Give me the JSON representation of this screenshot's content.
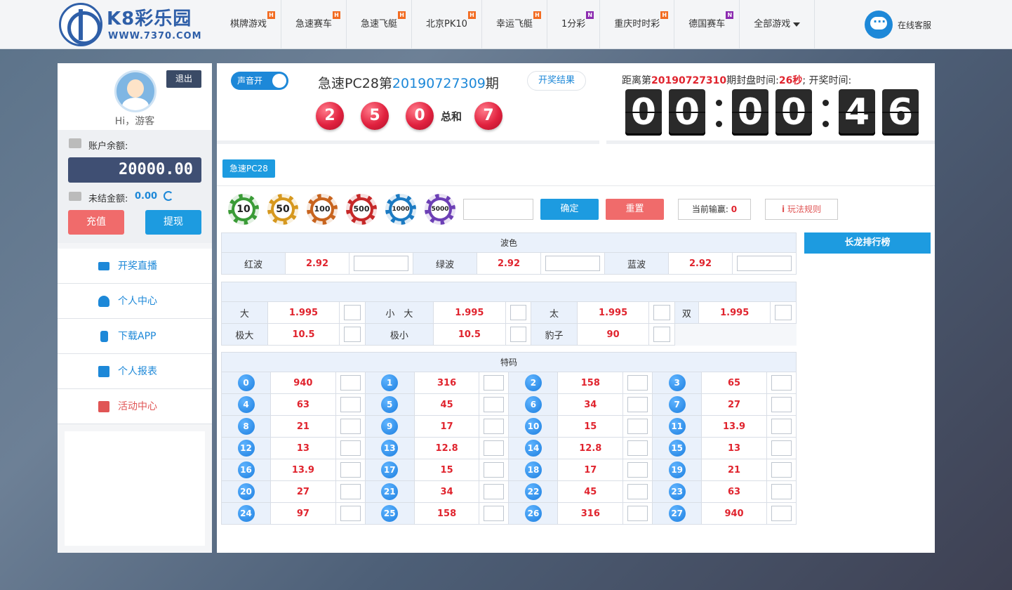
{
  "brand": {
    "title": "K8彩乐园",
    "url": "WWW.7370.COM"
  },
  "nav": [
    {
      "label": "棋牌游戏",
      "badge": "H"
    },
    {
      "label": "急速赛车",
      "badge": "H"
    },
    {
      "label": "急速飞艇",
      "badge": "H"
    },
    {
      "label": "北京PK10",
      "badge": "H"
    },
    {
      "label": "幸运飞艇",
      "badge": "H"
    },
    {
      "label": "1分彩",
      "badge": "N"
    },
    {
      "label": "重庆时时彩",
      "badge": "H"
    },
    {
      "label": "德国赛车",
      "badge": "N"
    },
    {
      "label": "全部游戏",
      "badge": ""
    }
  ],
  "service_label": "在线客服",
  "user": {
    "logout": "退出",
    "greeting": "Hi，游客",
    "balance_label": "账户余额:",
    "balance": "20000.00",
    "unsettled_label": "未结金额:",
    "unsettled": "0.00",
    "recharge": "充值",
    "withdraw": "提现"
  },
  "menu": [
    {
      "label": "开奖直播",
      "icon": "monitor-icon"
    },
    {
      "label": "个人中心",
      "icon": "user-icon"
    },
    {
      "label": "下载APP",
      "icon": "phone-icon"
    },
    {
      "label": "个人报表",
      "icon": "edit-icon"
    },
    {
      "label": "活动中心",
      "icon": "gift-icon"
    }
  ],
  "draw": {
    "sound": "声音开",
    "game": "急速PC28第",
    "period": "20190727309",
    "period_suffix": "期",
    "result_btn": "开奖结果",
    "balls": [
      "2",
      "5",
      "0"
    ],
    "sum_label": "总和",
    "sum": "7"
  },
  "timer": {
    "prefix": "距离第",
    "next_period": "20190727310",
    "mid": "期封盘时间:",
    "close_seconds": "26秒",
    "suffix": "; 开奖时间:",
    "digits": [
      "0",
      "0",
      "0",
      "0",
      "4",
      "6"
    ]
  },
  "game_tab": "急速PC28",
  "chips": [
    "10",
    "50",
    "100",
    "500",
    "1000",
    "5000"
  ],
  "controls": {
    "confirm": "确定",
    "reset": "重置",
    "winloss_label": "当前输赢:",
    "winloss_value": "0",
    "rules": "玩法规则",
    "dragon": "长龙排行榜"
  },
  "wave": {
    "title": "波色",
    "items": [
      {
        "label": "红波",
        "odds": "2.92"
      },
      {
        "label": "绿波",
        "odds": "2.92"
      },
      {
        "label": "蓝波",
        "odds": "2.92"
      }
    ]
  },
  "bigsmall": {
    "row1": [
      {
        "label": "大",
        "odds": "1.995"
      },
      {
        "label": "小　大",
        "odds": "1.995"
      },
      {
        "label": "太",
        "odds": "1.995"
      },
      {
        "label": "双",
        "odds": "1.995"
      }
    ],
    "row2": [
      {
        "label": "极大",
        "odds": "10.5"
      },
      {
        "label": "极小",
        "odds": "10.5"
      },
      {
        "label": "豹子",
        "odds": "90"
      }
    ]
  },
  "special": {
    "title": "特码",
    "rows": [
      [
        [
          "0",
          "940"
        ],
        [
          "1",
          "316"
        ],
        [
          "2",
          "158"
        ],
        [
          "3",
          "65"
        ]
      ],
      [
        [
          "4",
          "63"
        ],
        [
          "5",
          "45"
        ],
        [
          "6",
          "34"
        ],
        [
          "7",
          "27"
        ]
      ],
      [
        [
          "8",
          "21"
        ],
        [
          "9",
          "17"
        ],
        [
          "10",
          "15"
        ],
        [
          "11",
          "13.9"
        ]
      ],
      [
        [
          "12",
          "13"
        ],
        [
          "13",
          "12.8"
        ],
        [
          "14",
          "12.8"
        ],
        [
          "15",
          "13"
        ]
      ],
      [
        [
          "16",
          "13.9"
        ],
        [
          "17",
          "15"
        ],
        [
          "18",
          "17"
        ],
        [
          "19",
          "21"
        ]
      ],
      [
        [
          "20",
          "27"
        ],
        [
          "21",
          "34"
        ],
        [
          "22",
          "45"
        ],
        [
          "23",
          "63"
        ]
      ],
      [
        [
          "24",
          "97"
        ],
        [
          "25",
          "158"
        ],
        [
          "26",
          "316"
        ],
        [
          "27",
          "940"
        ]
      ]
    ]
  }
}
